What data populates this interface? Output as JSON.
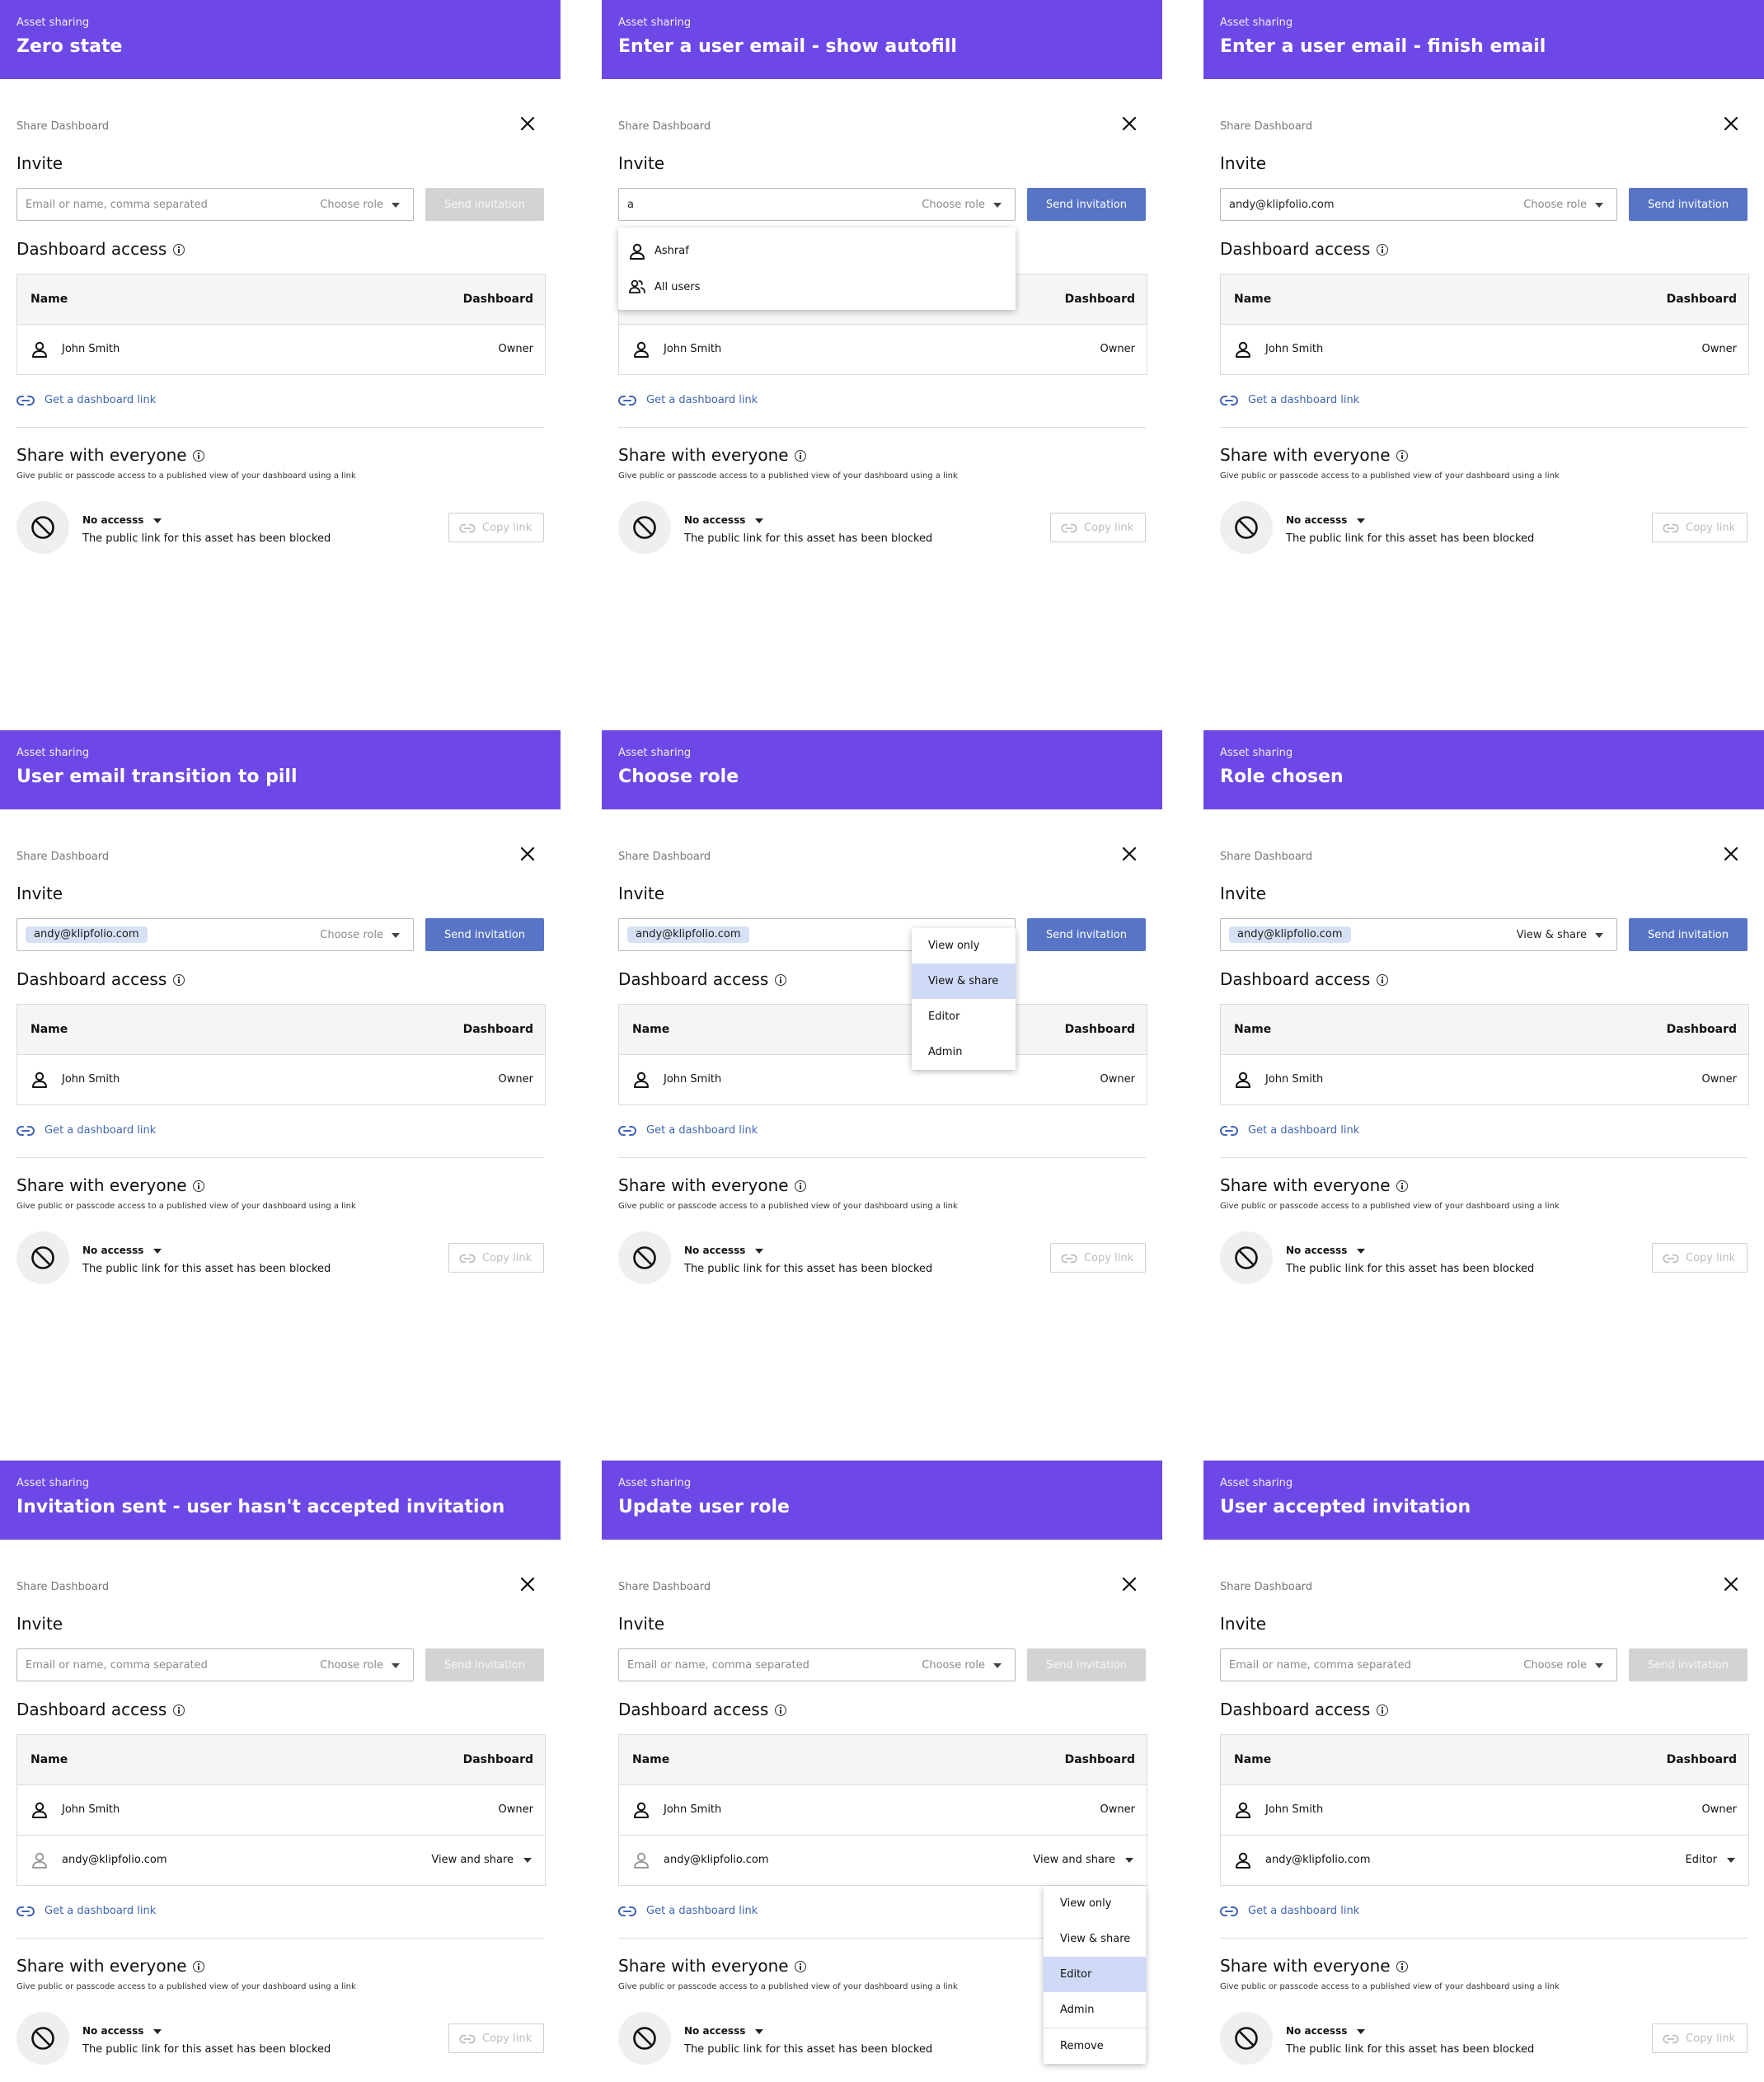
{
  "colors": {
    "header": "#6e48e6",
    "send_enabled": "#5874c6",
    "send_disabled": "#d3d3d3",
    "link": "#4065b4",
    "pill": "#d7e1f5",
    "menu_highlight": "#cfdaf6"
  },
  "icons": [
    "close-icon",
    "info-icon",
    "user-icon",
    "group-icon",
    "link-icon",
    "block-icon",
    "caret-down-icon"
  ],
  "panels": [
    {
      "header_sub": "Asset sharing",
      "header_title": "Zero state",
      "share_title": "Share Dashboard",
      "invite_heading": "Invite",
      "input_value": "",
      "input_placeholder": "Email or name, comma separated",
      "role_value": "Choose role",
      "send_label": "Send invitation",
      "access_heading": "Dashboard access",
      "col_name": "Name",
      "col_dashboard": "Dashboard",
      "rows": [
        {
          "name": "John Smith",
          "role": "Owner"
        }
      ],
      "link_label": "Get a dashboard link",
      "everyone_heading": "Share with everyone",
      "everyone_desc": "Give public or passcode access to a published view of your dashboard using a link",
      "no_access_label": "No accesss",
      "blocked_desc": "The public link for this asset has been blocked",
      "copy_label": "Copy link"
    },
    {
      "header_sub": "Asset sharing",
      "header_title": "Enter a user email - show autofill",
      "share_title": "Share Dashboard",
      "invite_heading": "Invite",
      "input_value": "a",
      "input_placeholder": "Email or name, comma separated",
      "role_value": "Choose role",
      "send_label": "Send invitation",
      "access_heading": "Dashboard access",
      "col_name": "Name",
      "col_dashboard": "Dashboard",
      "rows": [
        {
          "name": "John Smith",
          "role": "Owner"
        }
      ],
      "autofill": [
        "Ashraf",
        "All users"
      ],
      "link_label": "Get a dashboard link",
      "everyone_heading": "Share with everyone",
      "everyone_desc": "Give public or passcode access to a published view of your dashboard using a link",
      "no_access_label": "No accesss",
      "blocked_desc": "The public link for this asset has been blocked",
      "copy_label": "Copy link"
    },
    {
      "header_sub": "Asset sharing",
      "header_title": "Enter a user email - finish email",
      "share_title": "Share Dashboard",
      "invite_heading": "Invite",
      "input_value": "andy@klipfolio.com",
      "input_placeholder": "Email or name, comma separated",
      "role_value": "Choose role",
      "send_label": "Send invitation",
      "access_heading": "Dashboard access",
      "col_name": "Name",
      "col_dashboard": "Dashboard",
      "rows": [
        {
          "name": "John Smith",
          "role": "Owner"
        }
      ],
      "link_label": "Get a dashboard link",
      "everyone_heading": "Share with everyone",
      "everyone_desc": "Give public or passcode access to a published view of your dashboard using a link",
      "no_access_label": "No accesss",
      "blocked_desc": "The public link for this asset has been blocked",
      "copy_label": "Copy link"
    },
    {
      "header_sub": "Asset sharing",
      "header_title": "User email transition to pill",
      "share_title": "Share Dashboard",
      "invite_heading": "Invite",
      "pill": "andy@klipfolio.com",
      "role_value": "Choose role",
      "send_label": "Send invitation",
      "access_heading": "Dashboard access",
      "col_name": "Name",
      "col_dashboard": "Dashboard",
      "rows": [
        {
          "name": "John Smith",
          "role": "Owner"
        }
      ],
      "link_label": "Get a dashboard link",
      "everyone_heading": "Share with everyone",
      "everyone_desc": "Give public or passcode access to a published view of your dashboard using a link",
      "no_access_label": "No accesss",
      "blocked_desc": "The public link for this asset has been blocked",
      "copy_label": "Copy link"
    },
    {
      "header_sub": "Asset sharing",
      "header_title": "Choose role",
      "share_title": "Share Dashboard",
      "invite_heading": "Invite",
      "pill": "andy@klipfolio.com",
      "role_value": "",
      "send_label": "Send invitation",
      "access_heading": "Dashboard access",
      "col_name": "Name",
      "col_dashboard": "Dashboard",
      "rows": [
        {
          "name": "John Smith",
          "role": "Owner"
        }
      ],
      "role_menu": [
        "View only",
        "View & share",
        "Editor",
        "Admin"
      ],
      "role_menu_selected": "View & share",
      "link_label": "Get a dashboard link",
      "everyone_heading": "Share with everyone",
      "everyone_desc": "Give public or passcode access to a published view of your dashboard using a link",
      "no_access_label": "No accesss",
      "blocked_desc": "The public link for this asset has been blocked",
      "copy_label": "Copy link"
    },
    {
      "header_sub": "Asset sharing",
      "header_title": "Role chosen",
      "share_title": "Share Dashboard",
      "invite_heading": "Invite",
      "pill": "andy@klipfolio.com",
      "role_value": "View & share",
      "send_label": "Send invitation",
      "access_heading": "Dashboard access",
      "col_name": "Name",
      "col_dashboard": "Dashboard",
      "rows": [
        {
          "name": "John Smith",
          "role": "Owner"
        }
      ],
      "link_label": "Get a dashboard link",
      "everyone_heading": "Share with everyone",
      "everyone_desc": "Give public or passcode access to a published view of your dashboard using a link",
      "no_access_label": "No accesss",
      "blocked_desc": "The public link for this asset has been blocked",
      "copy_label": "Copy link"
    },
    {
      "header_sub": "Asset sharing",
      "header_title": "Invitation sent - user hasn't accepted invitation",
      "share_title": "Share Dashboard",
      "invite_heading": "Invite",
      "input_value": "",
      "input_placeholder": "Email or name, comma separated",
      "role_value": "Choose role",
      "send_label": "Send invitation",
      "access_heading": "Dashboard access",
      "col_name": "Name",
      "col_dashboard": "Dashboard",
      "rows": [
        {
          "name": "John Smith",
          "role": "Owner"
        },
        {
          "name": "andy@klipfolio.com",
          "role": "View and share",
          "pending": true
        }
      ],
      "link_label": "Get a dashboard link",
      "everyone_heading": "Share with everyone",
      "everyone_desc": "Give public or passcode access to a published view of your dashboard using a link",
      "no_access_label": "No accesss",
      "blocked_desc": "The public link for this asset has been blocked",
      "copy_label": "Copy link"
    },
    {
      "header_sub": "Asset sharing",
      "header_title": "Update user role",
      "share_title": "Share Dashboard",
      "invite_heading": "Invite",
      "input_value": "",
      "input_placeholder": "Email or name, comma separated",
      "role_value": "Choose role",
      "send_label": "Send invitation",
      "access_heading": "Dashboard access",
      "col_name": "Name",
      "col_dashboard": "Dashboard",
      "rows": [
        {
          "name": "John Smith",
          "role": "Owner"
        },
        {
          "name": "andy@klipfolio.com",
          "role": "View and share",
          "pending": true
        }
      ],
      "row_menu": [
        "View only",
        "View & share",
        "Editor",
        "Admin",
        "Remove"
      ],
      "row_menu_selected": "Editor",
      "link_label": "Get a dashboard link",
      "everyone_heading": "Share with everyone",
      "everyone_desc": "Give public or passcode access to a published view of your dashboard using a link",
      "no_access_label": "No accesss",
      "blocked_desc": "The public link for this asset has been blocked",
      "copy_label": "Copy link"
    },
    {
      "header_sub": "Asset sharing",
      "header_title": "User accepted invitation",
      "share_title": "Share Dashboard",
      "invite_heading": "Invite",
      "input_value": "",
      "input_placeholder": "Email or name, comma separated",
      "role_value": "Choose role",
      "send_label": "Send invitation",
      "access_heading": "Dashboard access",
      "col_name": "Name",
      "col_dashboard": "Dashboard",
      "rows": [
        {
          "name": "John Smith",
          "role": "Owner"
        },
        {
          "name": "andy@klipfolio.com",
          "role": "Editor"
        }
      ],
      "link_label": "Get a dashboard link",
      "everyone_heading": "Share with everyone",
      "everyone_desc": "Give public or passcode access to a published view of your dashboard using a link",
      "no_access_label": "No accesss",
      "blocked_desc": "The public link for this asset has been blocked",
      "copy_label": "Copy link"
    }
  ]
}
